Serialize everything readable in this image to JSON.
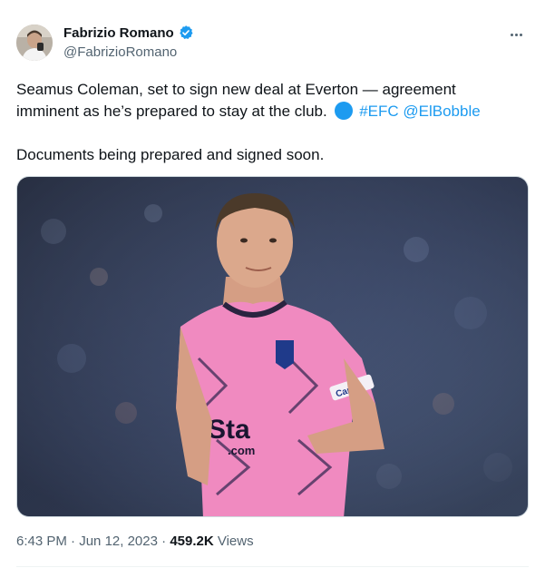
{
  "author": {
    "display_name": "Fabrizio Romano",
    "handle": "@FabrizioRomano",
    "verified": true,
    "avatar_icon": "profile-photo"
  },
  "tweet": {
    "line1": "Seamus Coleman, set to sign new deal at Everton — agreement",
    "line2_text": "imminent as he’s prepared to stay at the club.",
    "hashtag": "#EFC",
    "mention": "@ElBobble",
    "line3": "Documents being prepared and signed soon."
  },
  "media": {
    "jersey_sponsor": "Stake.com",
    "captain_band": "Captain"
  },
  "meta": {
    "time": "6:43 PM",
    "separator": "·",
    "date": "Jun 12, 2023",
    "views_count": "459.2K",
    "views_label": "Views"
  },
  "colors": {
    "link": "#1d9bf0",
    "secondary_text": "#536471",
    "jersey_pink": "#f08ac0"
  }
}
